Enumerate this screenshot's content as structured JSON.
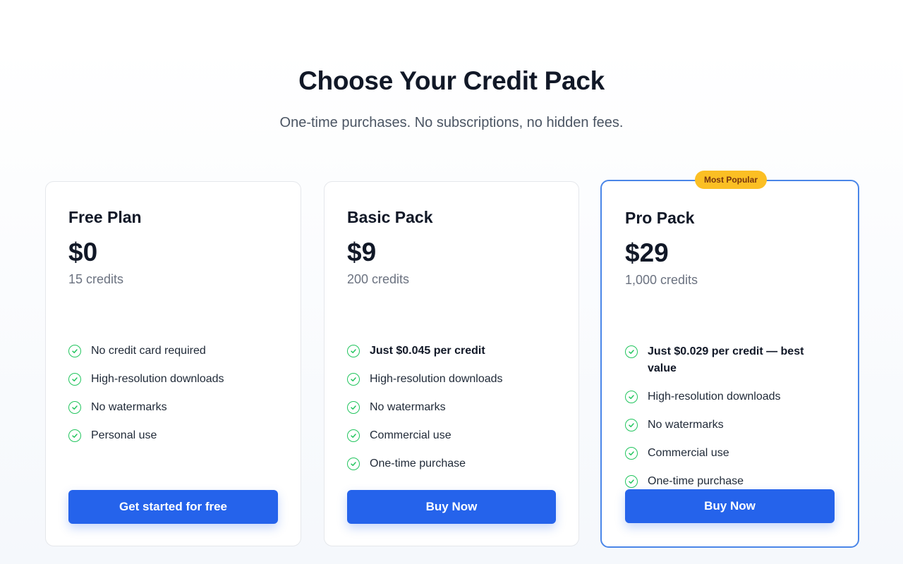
{
  "header": {
    "title": "Choose Your Credit Pack",
    "subtitle": "One-time purchases. No subscriptions, no hidden fees."
  },
  "plans": [
    {
      "name": "Free Plan",
      "price": "$0",
      "credits": "15 credits",
      "features": [
        {
          "text": "No credit card required",
          "bold": false
        },
        {
          "text": "High-resolution downloads",
          "bold": false
        },
        {
          "text": "No watermarks",
          "bold": false
        },
        {
          "text": "Personal use",
          "bold": false
        }
      ],
      "cta": "Get started for free"
    },
    {
      "name": "Basic Pack",
      "price": "$9",
      "credits": "200 credits",
      "features": [
        {
          "text": "Just $0.045 per credit",
          "bold": true
        },
        {
          "text": "High-resolution downloads",
          "bold": false
        },
        {
          "text": "No watermarks",
          "bold": false
        },
        {
          "text": "Commercial use",
          "bold": false
        },
        {
          "text": "One-time purchase",
          "bold": false
        }
      ],
      "cta": "Buy Now"
    },
    {
      "name": "Pro Pack",
      "badge": "Most Popular",
      "price": "$29",
      "credits": "1,000 credits",
      "features": [
        {
          "text": "Just $0.029 per credit — best value",
          "bold": true
        },
        {
          "text": "High-resolution downloads",
          "bold": false
        },
        {
          "text": "No watermarks",
          "bold": false
        },
        {
          "text": "Commercial use",
          "bold": false
        },
        {
          "text": "One-time purchase",
          "bold": false
        }
      ],
      "cta": "Buy Now"
    }
  ],
  "icons": {
    "feature": "check-circle-icon"
  },
  "colors": {
    "accent": "#2563eb",
    "highlight_border": "#4a86e8",
    "badge": "#fbbf24",
    "check": "#22c55e"
  }
}
